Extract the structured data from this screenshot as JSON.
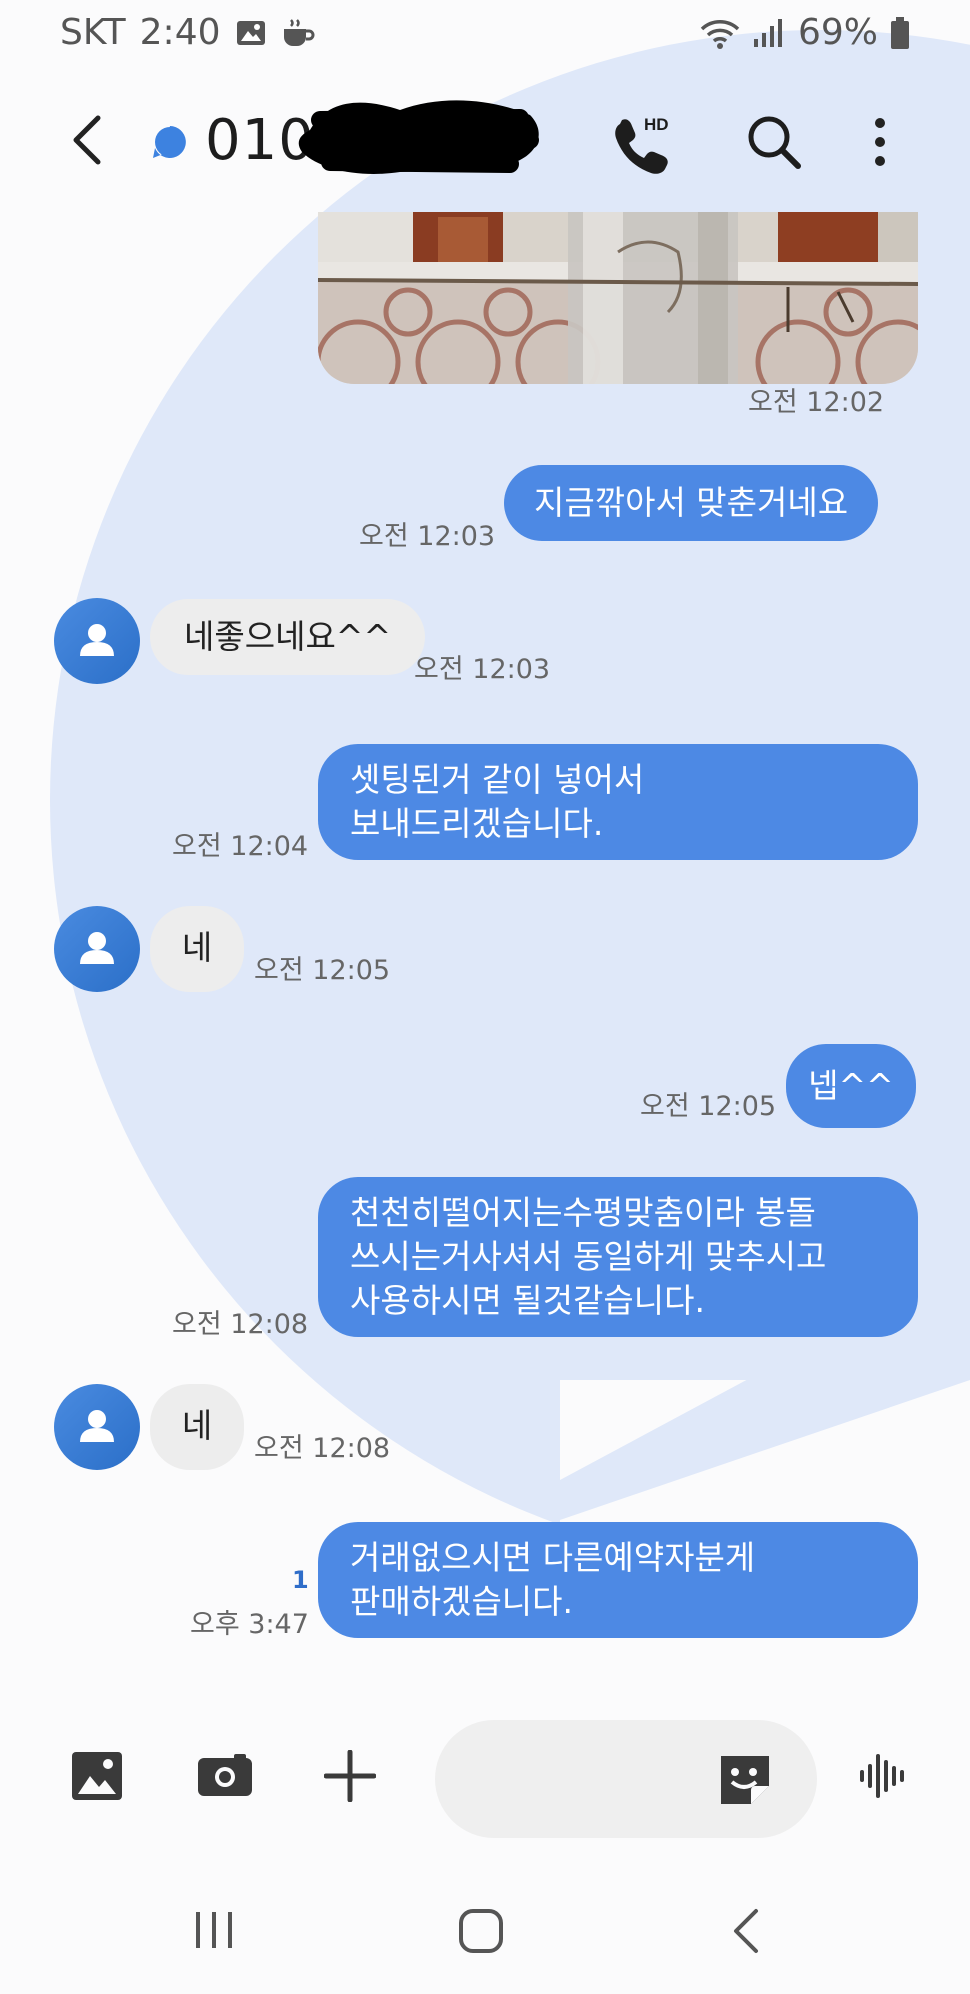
{
  "status_bar": {
    "carrier": "SKT",
    "time": "2:40",
    "battery": "69%",
    "icons": [
      "gallery-icon",
      "coffee-icon",
      "wifi-icon",
      "signal-icon",
      "battery-icon"
    ]
  },
  "header": {
    "title": "010",
    "icons": [
      "back-icon",
      "online-dot-icon",
      "hd-call-icon",
      "search-icon",
      "more-icon"
    ]
  },
  "messages": [
    {
      "dir": "out",
      "type": "image",
      "time": "오전 12:02"
    },
    {
      "dir": "out",
      "lines": [
        "지금깎아서 맞춘거네요"
      ],
      "time": "오전 12:03"
    },
    {
      "dir": "in",
      "lines": [
        "네좋으네요^^"
      ],
      "time": "오전 12:03"
    },
    {
      "dir": "out",
      "lines": [
        "셋팅된거 같이 넣어서",
        "보내드리겠습니다."
      ],
      "time": "오전 12:04"
    },
    {
      "dir": "in",
      "lines": [
        "네"
      ],
      "time": "오전 12:05"
    },
    {
      "dir": "out",
      "lines": [
        "넵^^"
      ],
      "time": "오전 12:05"
    },
    {
      "dir": "out",
      "lines": [
        "천천히떨어지는수평맞춤이라 봉돌",
        "쓰시는거사셔서 동일하게 맞추시고",
        "사용하시면 될것같습니다."
      ],
      "time": "오전 12:08"
    },
    {
      "dir": "in",
      "lines": [
        "네"
      ],
      "time": "오전 12:08"
    },
    {
      "dir": "out",
      "lines": [
        "거래없으시면 다른예약자분게",
        "판매하겠습니다."
      ],
      "time": "오후 3:47",
      "unread": "1"
    }
  ],
  "composer": {
    "placeholder": "",
    "icons": [
      "gallery-icon",
      "camera-icon",
      "plus-icon",
      "sticker-icon",
      "voice-icon"
    ]
  },
  "colors": {
    "outgoing_bubble": "#4d89e4",
    "incoming_bubble": "#ededed",
    "background_decor": "#dfe8f9",
    "avatar": "#3a7bd5"
  }
}
